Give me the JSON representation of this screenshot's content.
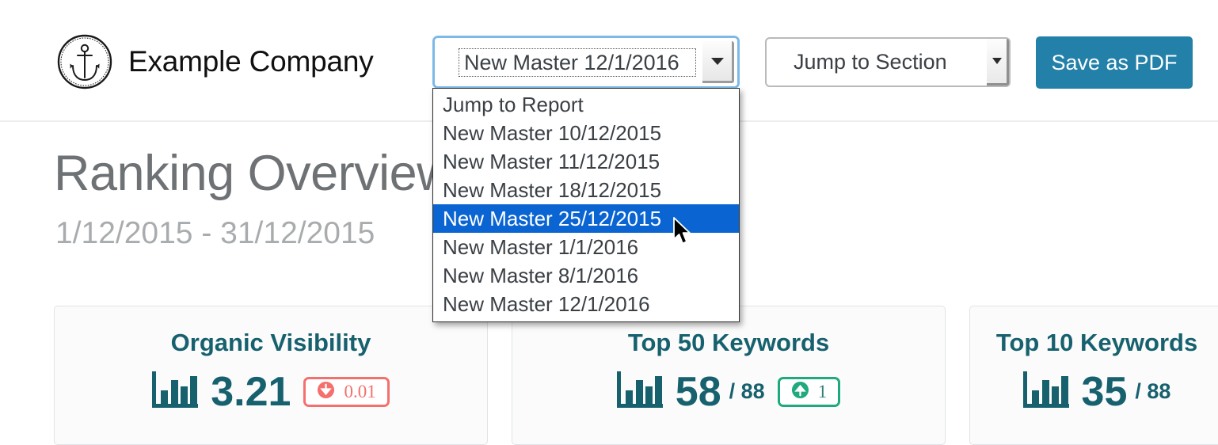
{
  "header": {
    "logo_icon": "anchor-circle-logo",
    "brand_name": "Example Company",
    "report_select": {
      "icon": "chevron-down-icon",
      "selected_value": "New Master 12/1/2016",
      "options": [
        "Jump to Report",
        "New Master 10/12/2015",
        "New Master 11/12/2015",
        "New Master 18/12/2015",
        "New Master 25/12/2015",
        "New Master 1/1/2016",
        "New Master 8/1/2016",
        "New Master 12/1/2016"
      ],
      "highlighted_index": 4,
      "highlight_color": "#0a64d2",
      "is_open": true
    },
    "section_select": {
      "icon": "chevron-down-icon",
      "selected_value": "Jump to Section"
    },
    "save_pdf_label": "Save as PDF",
    "save_pdf_color": "#2380a8"
  },
  "page": {
    "title": "Ranking Overview",
    "date_range": "1/12/2015 - 31/12/2015",
    "title_color": "#6f7275",
    "date_range_color": "#a9acae"
  },
  "cards": [
    {
      "title": "Organic Visibility",
      "icon": "bar-chart-icon",
      "value": "3.21",
      "total": "",
      "badge": {
        "icon": "arrow-down-circle-icon",
        "delta": "0.01",
        "direction": "down",
        "color": "#f4706e"
      }
    },
    {
      "title": "Top 50 Keywords",
      "icon": "bar-chart-icon",
      "value": "58",
      "total": "/ 88",
      "badge": {
        "icon": "arrow-up-circle-icon",
        "delta": "1",
        "direction": "up",
        "color": "#1fa97e"
      }
    },
    {
      "title": "Top 10 Keywords",
      "icon": "bar-chart-icon",
      "value": "35",
      "total": "/ 88",
      "badge": null
    }
  ],
  "theme": {
    "accent_teal": "#17616f",
    "button_teal": "#2380a8",
    "card_bg": "#fbfbfb",
    "card_border": "#e2e3e4"
  }
}
